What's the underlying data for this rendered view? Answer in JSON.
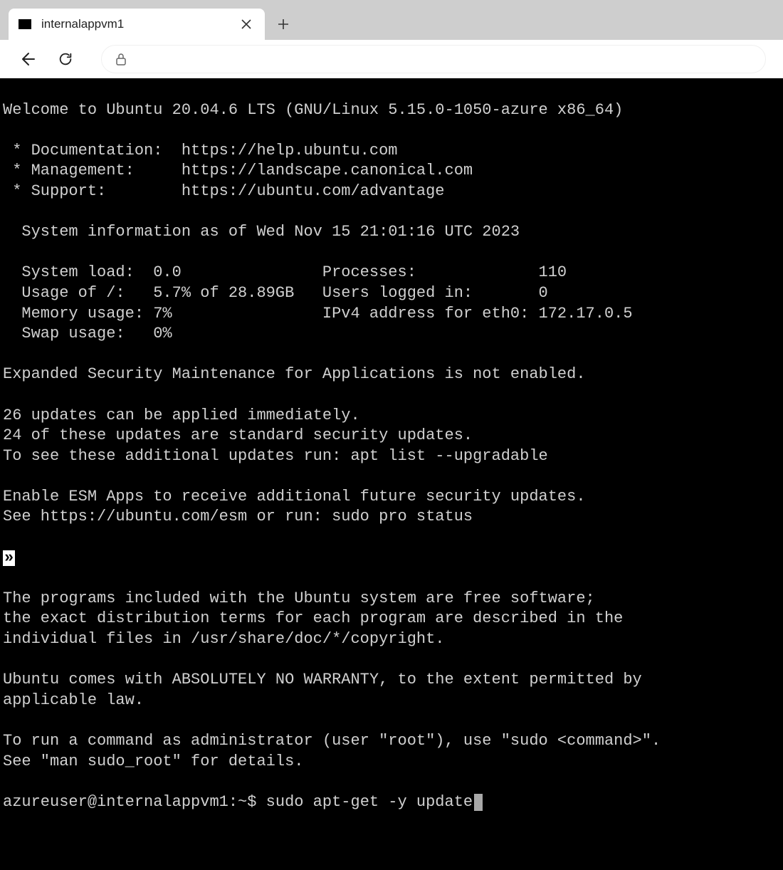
{
  "browser": {
    "tab_title": "internalappvm1"
  },
  "terminal": {
    "welcome": "Welcome to Ubuntu 20.04.6 LTS (GNU/Linux 5.15.0-1050-azure x86_64)",
    "links": {
      "doc_label": " * Documentation:  https://help.ubuntu.com",
      "mgmt_label": " * Management:     https://landscape.canonical.com",
      "support_label": " * Support:        https://ubuntu.com/advantage"
    },
    "sysinfo_header": "  System information as of Wed Nov 15 21:01:16 UTC 2023",
    "sysinfo": {
      "l1": "  System load:  0.0               Processes:             110",
      "l2": "  Usage of /:   5.7% of 28.89GB   Users logged in:       0",
      "l3": "  Memory usage: 7%                IPv4 address for eth0: 172.17.0.5",
      "l4": "  Swap usage:   0%"
    },
    "esm_line": "Expanded Security Maintenance for Applications is not enabled.",
    "updates": {
      "u1": "26 updates can be applied immediately.",
      "u2": "24 of these updates are standard security updates.",
      "u3": "To see these additional updates run: apt list --upgradable"
    },
    "esm2": {
      "e1": "Enable ESM Apps to receive additional future security updates.",
      "e2": "See https://ubuntu.com/esm or run: sudo pro status"
    },
    "chevrons": "»",
    "legal": {
      "p1": "The programs included with the Ubuntu system are free software;",
      "p2": "the exact distribution terms for each program are described in the",
      "p3": "individual files in /usr/share/doc/*/copyright.",
      "p4": "Ubuntu comes with ABSOLUTELY NO WARRANTY, to the extent permitted by",
      "p5": "applicable law."
    },
    "sudo_hint": {
      "s1": "To run a command as administrator (user \"root\"), use \"sudo <command>\".",
      "s2": "See \"man sudo_root\" for details."
    },
    "prompt": "azureuser@internalappvm1:~$ ",
    "command": "sudo apt-get -y update"
  }
}
